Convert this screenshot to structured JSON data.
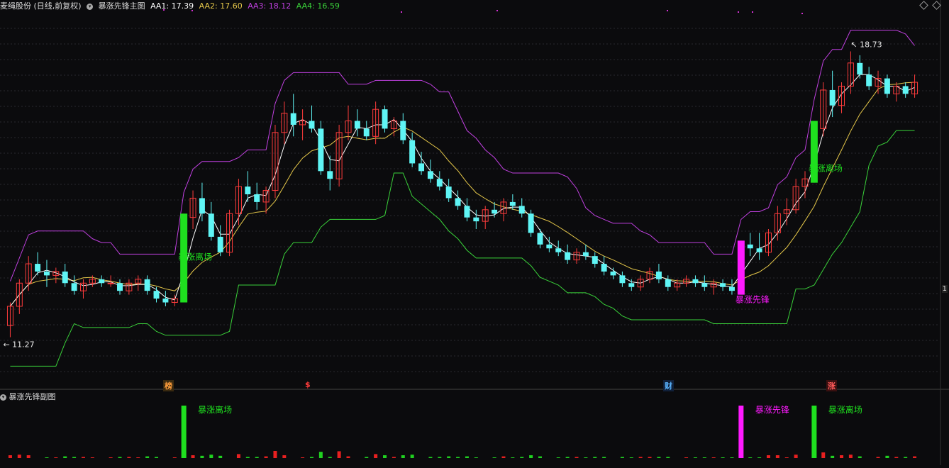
{
  "header": {
    "stock_name": "麦绳股份 (日线,前复权)",
    "indicator_name": "暴涨先锋主图",
    "aa1": "AA1: 17.39",
    "aa2": "AA2: 17.60",
    "aa3": "AA3: 18.12",
    "aa4": "AA4: 16.59"
  },
  "sub_header": {
    "indicator_name": "暴涨先锋副图"
  },
  "colors": {
    "up": "#ff3c3c",
    "down": "#5ff5f5",
    "aa1": "#ffffff",
    "aa2": "#e6c84a",
    "aa3": "#c040e0",
    "aa4": "#3ad23a",
    "signal_green": "#1fe01f",
    "signal_magenta": "#ff1aff"
  },
  "chart_data": {
    "type": "candlestick",
    "price_labels": {
      "low": "11.27",
      "high": "18.73"
    },
    "annotations": [
      {
        "text": "暴涨离场",
        "color": "green",
        "panel": "main"
      },
      {
        "text": "暴涨先锋",
        "color": "magenta",
        "panel": "main"
      },
      {
        "text": "暴涨离场",
        "color": "green",
        "panel": "main"
      }
    ],
    "sub_annotations": [
      {
        "text": "暴涨离场",
        "color": "green"
      },
      {
        "text": "暴涨先锋",
        "color": "magenta"
      },
      {
        "text": "暴涨离场",
        "color": "green"
      }
    ],
    "event_badges": [
      {
        "text": "榜",
        "color": "#ff9d3c"
      },
      {
        "text": "$",
        "color": "#ff3c3c"
      },
      {
        "text": "财",
        "color": "#5ab4ff"
      },
      {
        "text": "涨",
        "color": "#ff5a5a"
      }
    ],
    "scale_label": "1",
    "candles": [
      [
        11.6,
        12.2,
        11.3,
        12.1
      ],
      [
        12.1,
        12.8,
        11.9,
        12.7
      ],
      [
        12.7,
        13.4,
        12.5,
        13.2
      ],
      [
        13.2,
        13.5,
        12.9,
        13.0
      ],
      [
        13.0,
        13.3,
        12.6,
        12.9
      ],
      [
        12.9,
        13.1,
        12.7,
        13.0
      ],
      [
        13.0,
        13.2,
        12.6,
        12.7
      ],
      [
        12.7,
        12.9,
        12.4,
        12.5
      ],
      [
        12.5,
        12.8,
        12.3,
        12.7
      ],
      [
        12.7,
        12.9,
        12.6,
        12.8
      ],
      [
        12.8,
        12.9,
        12.6,
        12.7
      ],
      [
        12.7,
        12.9,
        12.6,
        12.7
      ],
      [
        12.7,
        12.8,
        12.4,
        12.5
      ],
      [
        12.5,
        12.8,
        12.4,
        12.7
      ],
      [
        12.7,
        12.9,
        12.5,
        12.8
      ],
      [
        12.8,
        12.9,
        12.4,
        12.5
      ],
      [
        12.5,
        12.6,
        12.2,
        12.3
      ],
      [
        12.3,
        12.5,
        12.1,
        12.2
      ],
      [
        12.2,
        12.4,
        12.1,
        12.3
      ],
      [
        12.3,
        14.5,
        12.2,
        14.4
      ],
      [
        14.4,
        15.1,
        14.1,
        14.9
      ],
      [
        14.9,
        15.3,
        14.3,
        14.5
      ],
      [
        14.5,
        14.8,
        13.8,
        13.9
      ],
      [
        13.9,
        14.2,
        13.4,
        13.5
      ],
      [
        13.5,
        14.6,
        13.4,
        14.5
      ],
      [
        14.5,
        15.4,
        14.2,
        15.2
      ],
      [
        15.2,
        15.6,
        14.8,
        15.0
      ],
      [
        15.0,
        15.3,
        14.6,
        14.8
      ],
      [
        14.8,
        15.2,
        14.5,
        15.1
      ],
      [
        15.1,
        16.8,
        14.9,
        16.6
      ],
      [
        16.6,
        17.4,
        16.3,
        17.1
      ],
      [
        17.1,
        17.6,
        16.5,
        16.8
      ],
      [
        16.8,
        17.2,
        16.4,
        16.9
      ],
      [
        16.9,
        17.3,
        16.6,
        16.7
      ],
      [
        16.7,
        16.9,
        15.5,
        15.6
      ],
      [
        15.6,
        16.0,
        15.1,
        15.4
      ],
      [
        15.4,
        16.8,
        15.2,
        16.6
      ],
      [
        16.6,
        17.3,
        16.4,
        16.9
      ],
      [
        16.9,
        17.2,
        16.5,
        16.7
      ],
      [
        16.7,
        16.9,
        16.4,
        16.5
      ],
      [
        16.5,
        17.4,
        16.3,
        17.2
      ],
      [
        17.2,
        17.3,
        16.6,
        16.7
      ],
      [
        16.7,
        17.0,
        16.5,
        16.9
      ],
      [
        16.9,
        17.1,
        16.3,
        16.4
      ],
      [
        16.4,
        16.6,
        15.7,
        15.8
      ],
      [
        15.8,
        16.1,
        15.5,
        15.6
      ],
      [
        15.6,
        15.9,
        15.3,
        15.4
      ],
      [
        15.4,
        15.6,
        15.1,
        15.2
      ],
      [
        15.2,
        15.4,
        14.8,
        14.9
      ],
      [
        14.9,
        15.1,
        14.6,
        14.7
      ],
      [
        14.7,
        14.9,
        14.3,
        14.4
      ],
      [
        14.4,
        14.6,
        14.1,
        14.3
      ],
      [
        14.3,
        14.7,
        14.1,
        14.6
      ],
      [
        14.6,
        14.8,
        14.4,
        14.5
      ],
      [
        14.5,
        14.9,
        14.3,
        14.8
      ],
      [
        14.8,
        15.0,
        14.6,
        14.7
      ],
      [
        14.7,
        14.9,
        14.4,
        14.5
      ],
      [
        14.5,
        14.6,
        13.9,
        14.0
      ],
      [
        14.0,
        14.1,
        13.6,
        13.7
      ],
      [
        13.7,
        13.9,
        13.5,
        13.6
      ],
      [
        13.6,
        13.8,
        13.4,
        13.5
      ],
      [
        13.5,
        13.7,
        13.2,
        13.3
      ],
      [
        13.3,
        13.6,
        13.2,
        13.5
      ],
      [
        13.5,
        13.7,
        13.3,
        13.4
      ],
      [
        13.4,
        13.5,
        13.1,
        13.2
      ],
      [
        13.2,
        13.4,
        12.9,
        13.0
      ],
      [
        13.0,
        13.1,
        12.8,
        12.9
      ],
      [
        12.9,
        13.0,
        12.6,
        12.7
      ],
      [
        12.7,
        12.8,
        12.5,
        12.6
      ],
      [
        12.6,
        12.9,
        12.5,
        12.8
      ],
      [
        12.8,
        13.1,
        12.7,
        13.0
      ],
      [
        13.0,
        13.2,
        12.7,
        12.8
      ],
      [
        12.8,
        12.9,
        12.5,
        12.6
      ],
      [
        12.6,
        12.8,
        12.5,
        12.7
      ],
      [
        12.7,
        12.9,
        12.6,
        12.8
      ],
      [
        12.8,
        12.9,
        12.6,
        12.7
      ],
      [
        12.7,
        12.9,
        12.5,
        12.6
      ],
      [
        12.6,
        12.8,
        12.4,
        12.7
      ],
      [
        12.7,
        12.8,
        12.5,
        12.6
      ],
      [
        12.6,
        12.8,
        12.4,
        12.5
      ],
      [
        12.5,
        13.8,
        12.4,
        13.7
      ],
      [
        13.7,
        14.0,
        13.4,
        13.6
      ],
      [
        13.6,
        14.0,
        13.3,
        13.5
      ],
      [
        13.5,
        14.1,
        13.4,
        14.0
      ],
      [
        14.0,
        14.7,
        13.8,
        14.5
      ],
      [
        14.5,
        14.9,
        14.2,
        14.6
      ],
      [
        14.6,
        15.4,
        14.5,
        15.2
      ],
      [
        15.2,
        15.6,
        14.9,
        15.4
      ],
      [
        15.4,
        16.9,
        15.3,
        16.7
      ],
      [
        16.7,
        17.9,
        16.5,
        17.7
      ],
      [
        17.7,
        18.2,
        17.0,
        17.3
      ],
      [
        17.3,
        17.9,
        17.1,
        17.8
      ],
      [
        17.8,
        18.7,
        17.6,
        18.4
      ],
      [
        18.4,
        18.6,
        18.0,
        18.1
      ],
      [
        18.1,
        18.3,
        17.7,
        17.8
      ],
      [
        17.8,
        18.2,
        17.6,
        18.0
      ],
      [
        18.0,
        18.1,
        17.5,
        17.6
      ],
      [
        17.6,
        17.9,
        17.4,
        17.8
      ],
      [
        17.8,
        17.9,
        17.5,
        17.6
      ],
      [
        17.6,
        18.1,
        17.5,
        17.9
      ]
    ]
  }
}
